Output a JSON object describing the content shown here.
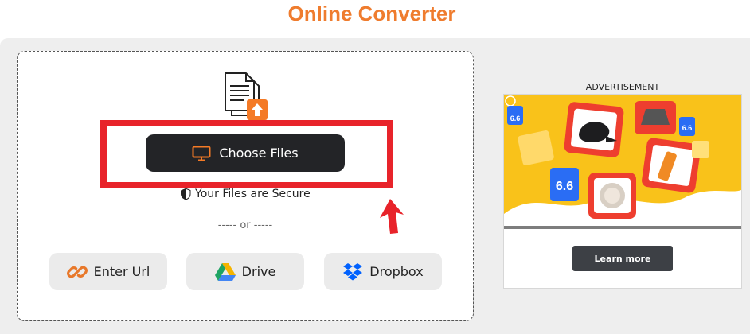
{
  "header": {
    "title": "Online Converter"
  },
  "upload": {
    "choose_label": "Choose Files",
    "secure_text": "Your Files are Secure",
    "or_text": "----- or -----"
  },
  "sources": [
    {
      "label": "Enter Url",
      "icon": "link-icon"
    },
    {
      "label": "Drive",
      "icon": "google-drive-icon"
    },
    {
      "label": "Dropbox",
      "icon": "dropbox-icon"
    }
  ],
  "ad": {
    "label": "ADVERTISEMENT",
    "badge_text": "6.6",
    "cta": "Learn more"
  },
  "colors": {
    "brand_orange": "#ef7c2e",
    "highlight_red": "#e8232a",
    "button_dark": "#232427",
    "ad_yellow": "#f9c21a"
  }
}
